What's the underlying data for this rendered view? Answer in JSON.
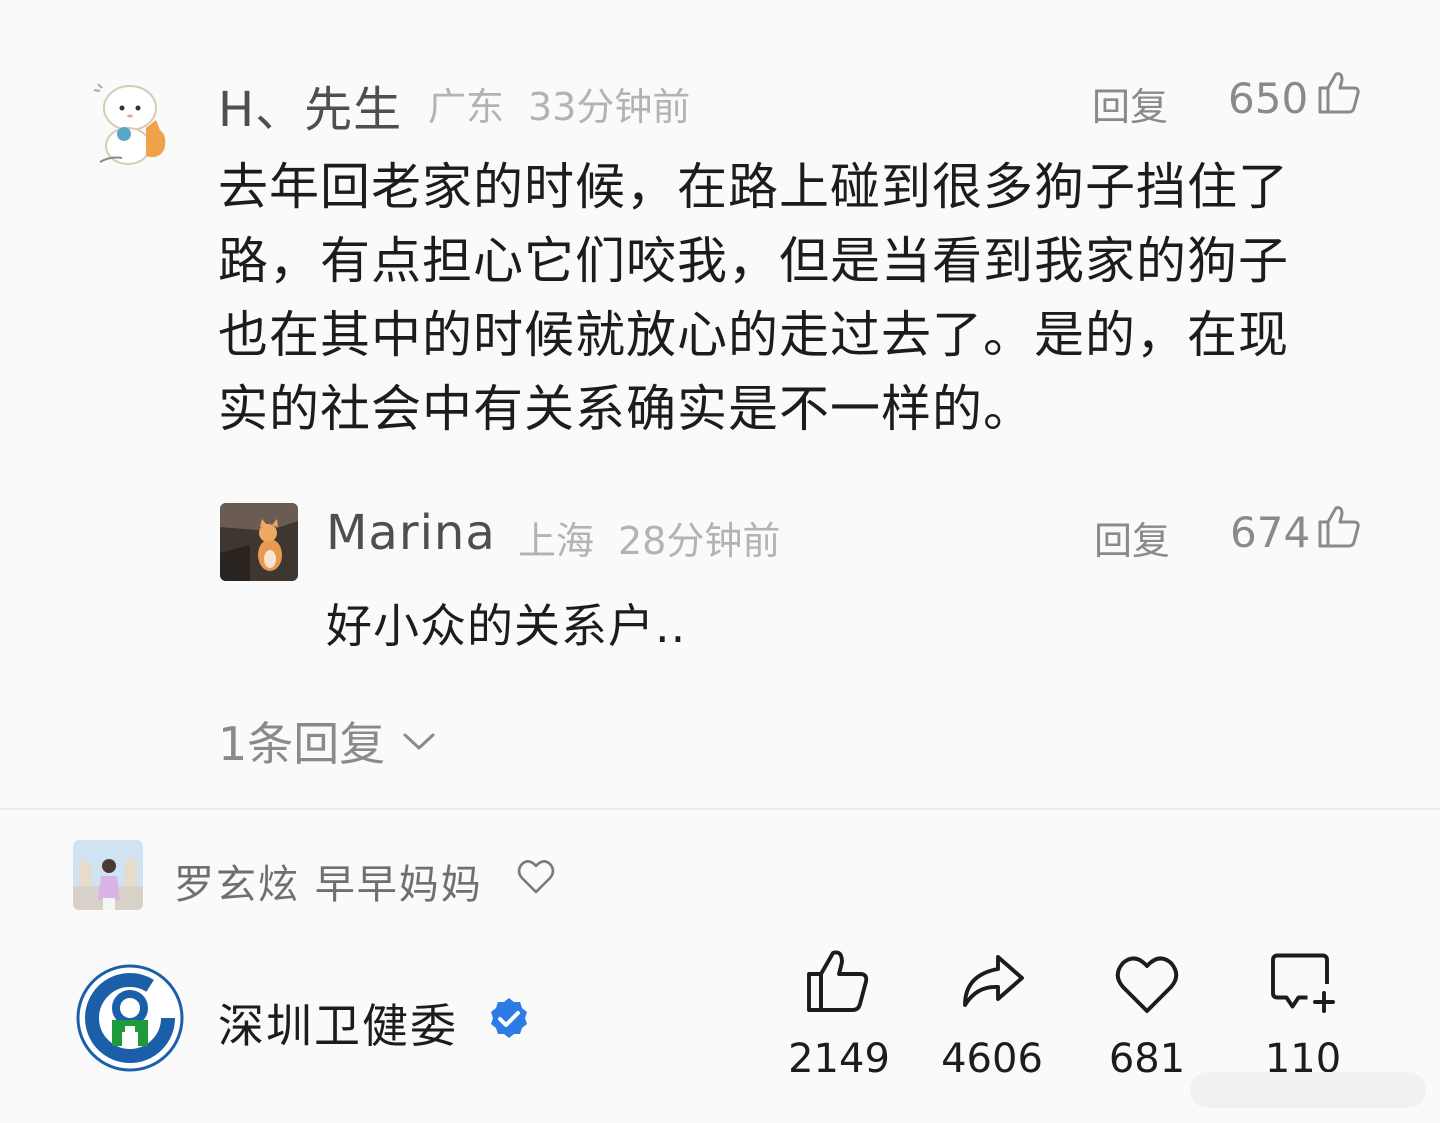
{
  "comment": {
    "user_name": "H、先生",
    "location": "广东",
    "time": "33分钟前",
    "reply_label": "回复",
    "like_count": "650",
    "text_lines": [
      "去年回老家的时候，在路上碰到很多狗子挡住了",
      "路，有点担心它们咬我，但是当看到我家的狗子",
      "也在其中的时候就放心的走过去了。是的，在现",
      "实的社会中有关系确实是不一样的。"
    ]
  },
  "reply": {
    "user_name": "Marina",
    "location": "上海",
    "time": "28分钟前",
    "reply_label": "回复",
    "like_count": "674",
    "text": "好小众的关系户.."
  },
  "more_replies": {
    "label": "1条回复",
    "icon": "chevron-down-icon"
  },
  "liked_by": {
    "text": "罗玄炫 早早妈妈",
    "icon": "heart-outline-icon"
  },
  "account": {
    "name": "深圳卫健委",
    "verified_icon": "verified-badge-icon",
    "verified_color": "#2e7be6",
    "logo_color": "#1b5fa8",
    "logo_green": "#1f9a3a"
  },
  "actions": [
    {
      "icon": "thumbs-up-icon",
      "count": "2149"
    },
    {
      "icon": "share-icon",
      "count": "4606"
    },
    {
      "icon": "heart-icon",
      "count": "681"
    },
    {
      "icon": "comment-add-icon",
      "count": "110"
    }
  ]
}
